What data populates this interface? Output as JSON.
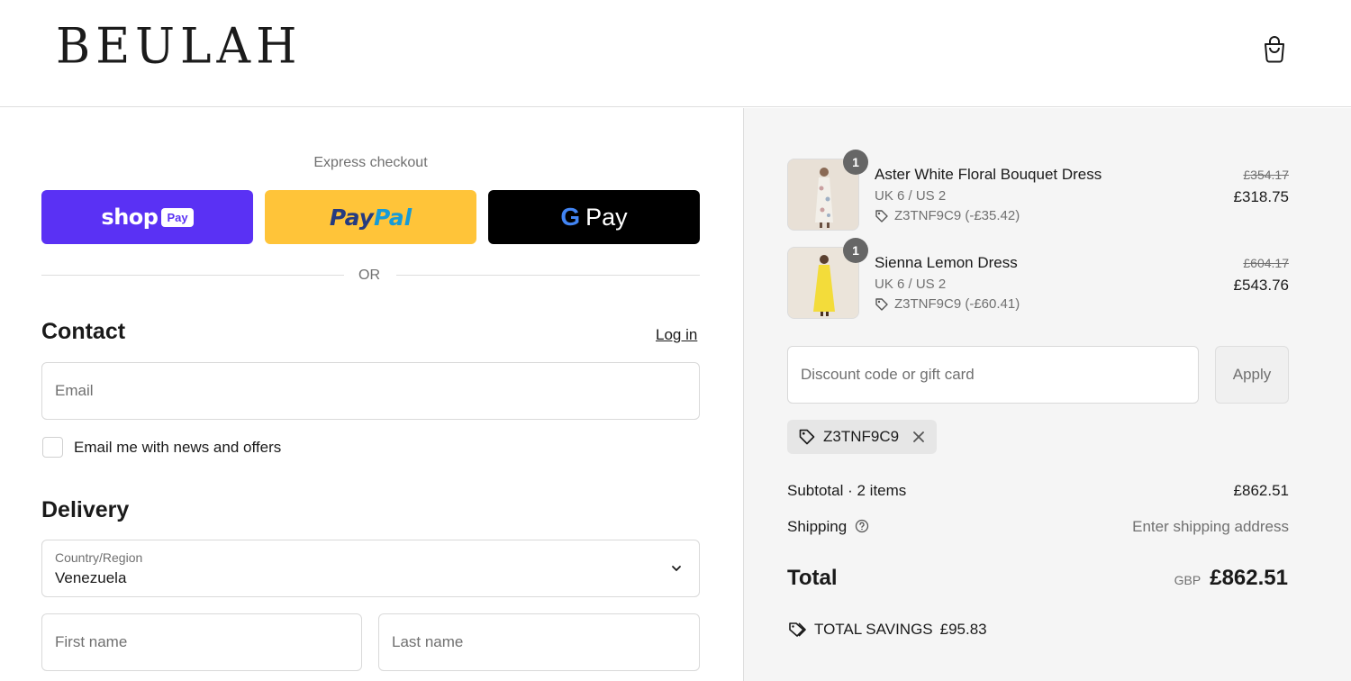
{
  "brand": {
    "logo": "BEULAH"
  },
  "express": {
    "title": "Express checkout",
    "shop_pay": {
      "word": "shop",
      "badge": "Pay"
    },
    "paypal": {
      "part1": "Pay",
      "part2": "Pal"
    },
    "gpay": {
      "g": "G",
      "word": "Pay"
    },
    "or": "OR"
  },
  "contact": {
    "title": "Contact",
    "login": "Log in",
    "email_placeholder": "Email",
    "newsletter_label": "Email me with news and offers"
  },
  "delivery": {
    "title": "Delivery",
    "country_label": "Country/Region",
    "country_value": "Venezuela",
    "first_name_placeholder": "First name",
    "last_name_placeholder": "Last name"
  },
  "order": {
    "items": [
      {
        "name": "Aster White Floral Bouquet Dress",
        "variant": "UK 6 / US 2",
        "discount": "Z3TNF9C9 (-£35.42)",
        "original_price": "£354.17",
        "price": "£318.75",
        "qty": "1"
      },
      {
        "name": "Sienna Lemon Dress",
        "variant": "UK 6 / US 2",
        "discount": "Z3TNF9C9 (-£60.41)",
        "original_price": "£604.17",
        "price": "£543.76",
        "qty": "1"
      }
    ],
    "discount_placeholder": "Discount code or gift card",
    "apply": "Apply",
    "applied_code": "Z3TNF9C9",
    "subtotal_label": "Subtotal · 2 items",
    "subtotal_value": "£862.51",
    "shipping_label": "Shipping",
    "shipping_value": "Enter shipping address",
    "total_label": "Total",
    "currency": "GBP",
    "total_value": "£862.51",
    "savings_label": "TOTAL SAVINGS",
    "savings_value": "£95.83"
  },
  "colors": {
    "shop_pay": "#5a31f4",
    "paypal": "#ffc439",
    "gpay": "#000000",
    "summary_bg": "#f5f5f5"
  }
}
